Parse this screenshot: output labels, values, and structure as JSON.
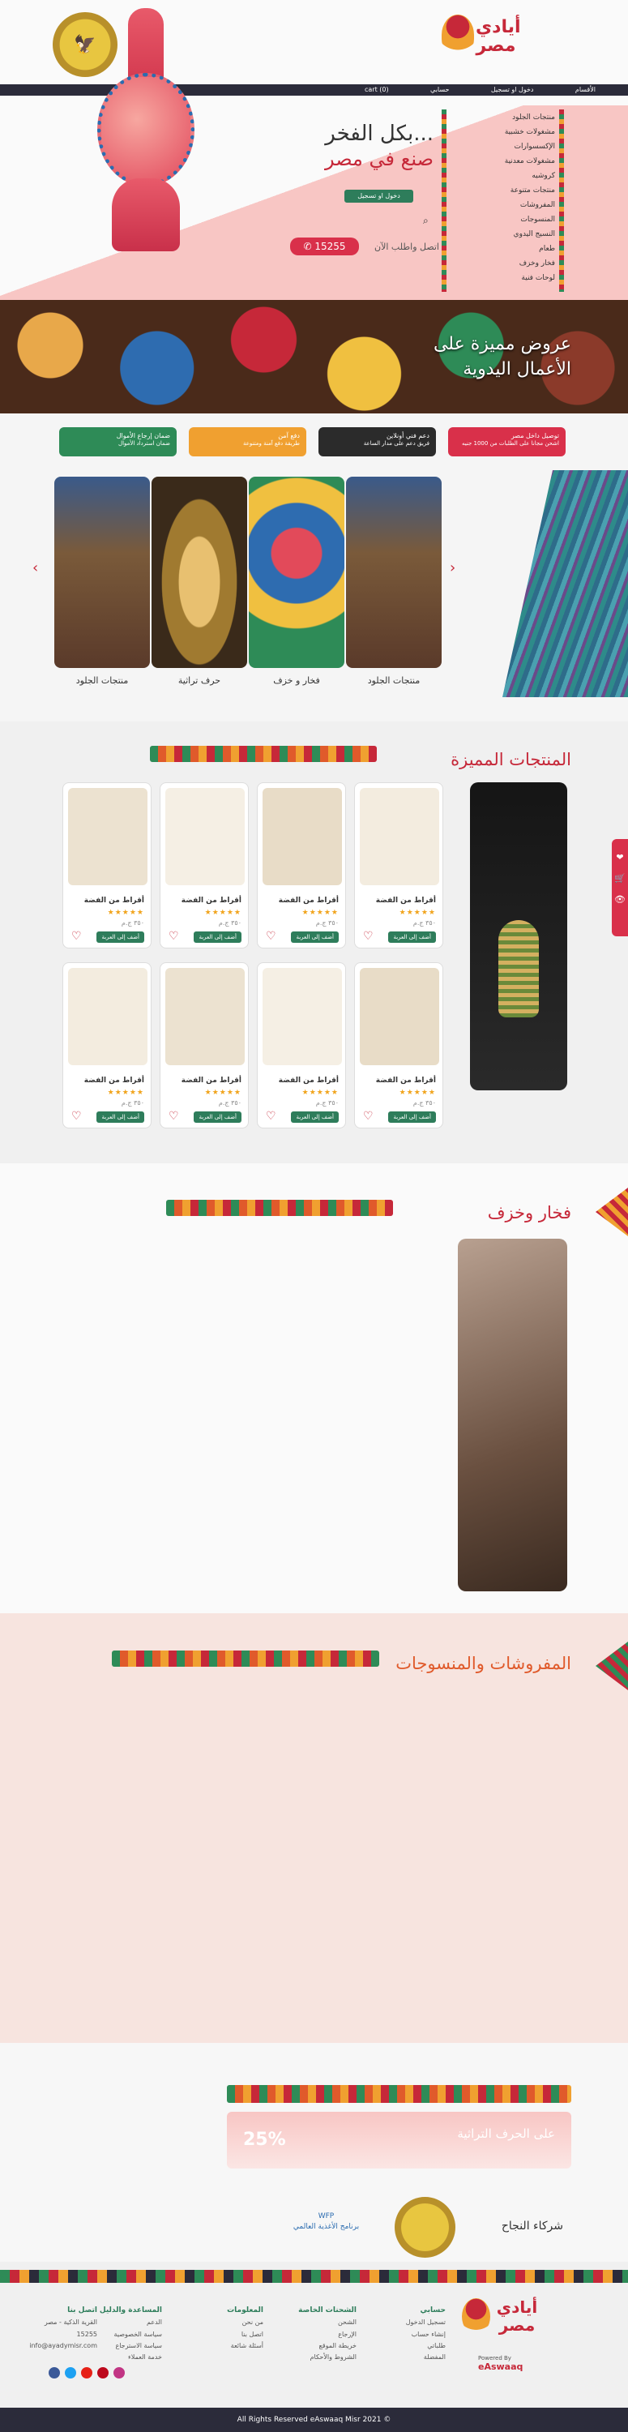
{
  "header": {
    "logo_text": "أيادي مصر",
    "emblem_text": "جمهورية مصر العربية",
    "nav": [
      "الأقسام",
      "دخول او تسجيل",
      "حسابي",
      "(0) cart"
    ],
    "hero_line1": "بكل الفخر...",
    "hero_line2": "صنع في مصر",
    "register_label": "دخول او تسجيل",
    "call_text": "اتصل واطلب الآن",
    "phone": "15255",
    "categories": [
      "منتجات الجلود",
      "مشغولات خشبية",
      "الإكسسوارات",
      "مشغولات معدنية",
      "كروشيه",
      "منتجات متنوعة",
      "المفروشات",
      "المنسوجات",
      "النسيج اليدوي",
      "طعام",
      "فخار وخزف",
      "لوحات فنية"
    ]
  },
  "banner": {
    "title": "عروض مميزة على الأعمال اليدوية"
  },
  "services": [
    {
      "title": "توصيل داخل مصر",
      "sub": "اشحن مجانا على الطلبات من 1000 جنيه",
      "color": "#d9304a"
    },
    {
      "title": "دعم فني أونلاين",
      "sub": "فريق دعم على مدار الساعة",
      "color": "#2b2b2b"
    },
    {
      "title": "دفع آمن",
      "sub": "طريقة دفع آمنة ومتنوعة",
      "color": "#f0a030"
    },
    {
      "title": "ضمان إرجاع الأموال",
      "sub": "ضمان استرداد الأموال",
      "color": "#2e8b57"
    }
  ],
  "category_thumbs": [
    "منتجات الجلود",
    "فخار و خزف",
    "حرف تراثية",
    "منتجات الجلود"
  ],
  "sections": [
    {
      "title": "المنتجات المميزة"
    },
    {
      "title": "فخار وخزف"
    },
    {
      "title": "المفروشات والمنسوجات"
    }
  ],
  "product": {
    "name": "أقراط من الفضة",
    "stars": "★★★★★",
    "price": "٣٥٠ ج.م",
    "button": "أضف إلى العربة"
  },
  "side_tools": [
    "❤",
    "🛒",
    "👁"
  ],
  "promo": {
    "percent": "25%",
    "text": "على الحرف التراثية"
  },
  "partners": {
    "title": "شركاء النجاح",
    "p1": "برنامج الأغذية العالمي",
    "p1_en": "WFP"
  },
  "footer": {
    "cols": [
      {
        "title": "حسابي",
        "items": [
          "تسجيل الدخول",
          "إنشاء حساب",
          "طلباتي",
          "المفضلة"
        ]
      },
      {
        "title": "الشحنات الخاصة",
        "items": [
          "الشحن",
          "الإرجاع",
          "خريطة الموقع",
          "الشروط والأحكام"
        ]
      },
      {
        "title": "المعلومات",
        "items": [
          "من نحن",
          "اتصل بنا",
          "أسئلة شائعة"
        ]
      },
      {
        "title": "المساعدة والدليل",
        "items": [
          "الدعم",
          "سياسة الخصوصية",
          "سياسة الاسترجاع",
          "خدمة العملاء"
        ]
      },
      {
        "title": "اتصل بنا",
        "items": [
          "القرية الذكية - مصر",
          "15255",
          "info@ayadymisr.com"
        ]
      }
    ],
    "powered": "Powered By",
    "powered_brand": "eAswaaq",
    "copyright": "All Rights Reserved eAswaaq Misr 2021 ©"
  },
  "colors": {
    "primary": "#c62839",
    "green": "#2e7d5b",
    "pink": "#f8c0c0"
  }
}
